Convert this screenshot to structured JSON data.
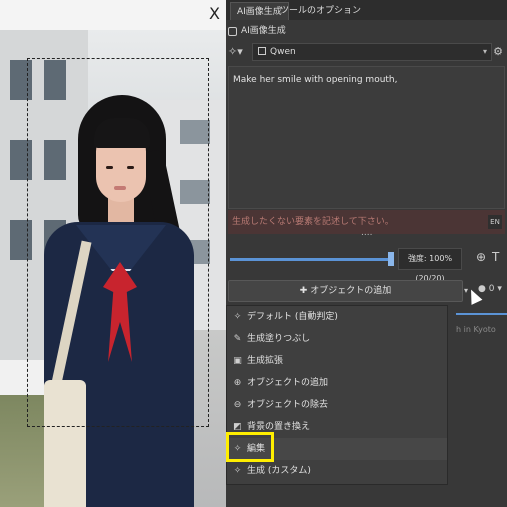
{
  "canvas": {
    "close_label": "X"
  },
  "panel": {
    "tabs": [
      "AI画像生成",
      "ツールのオプション"
    ],
    "title": "AI画像生成",
    "model": {
      "name": "Qwen"
    },
    "prompt": "Make her smile with opening mouth,",
    "negative_prompt_placeholder": "生成したくない要素を記述して下さい。",
    "lang_toggle": "EN",
    "strength_label": "強度: 100% (20/20)",
    "generate_button": "オブジェクトの追加",
    "queue_count": "0",
    "background_text": "h in Kyoto"
  },
  "menu": {
    "items": [
      {
        "label": "デフォルト (自動判定)",
        "icon": "wand-icon"
      },
      {
        "label": "生成塗りつぶし",
        "icon": "brush-icon"
      },
      {
        "label": "生成拡張",
        "icon": "expand-icon"
      },
      {
        "label": "オブジェクトの追加",
        "icon": "add-object-icon"
      },
      {
        "label": "オブジェクトの除去",
        "icon": "remove-object-icon"
      },
      {
        "label": "背景の置き換え",
        "icon": "background-icon"
      },
      {
        "label": "編集",
        "icon": "edit-wand-icon",
        "highlighted": true
      },
      {
        "label": "生成 (カスタム)",
        "icon": "custom-icon"
      }
    ]
  },
  "colors": {
    "accent": "#5b93d6",
    "highlight": "#ffee00",
    "negative_bg": "#4b3535"
  }
}
